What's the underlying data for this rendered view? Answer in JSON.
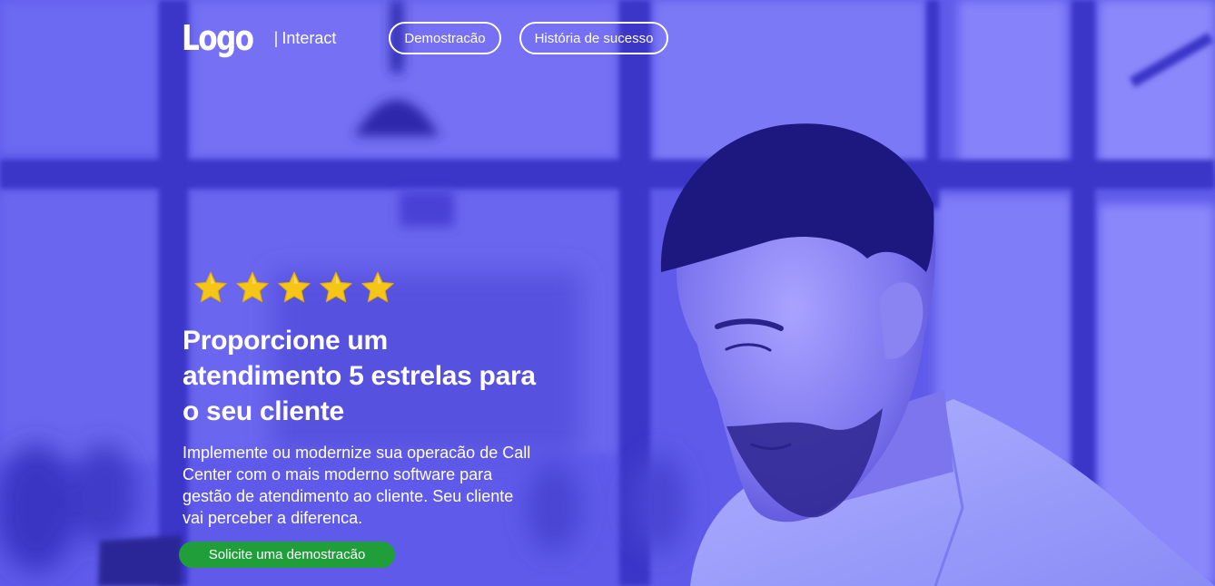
{
  "header": {
    "logo_text": "Logo",
    "brand_separator": "|",
    "brand_name": "Interact",
    "nav_buttons": [
      {
        "label": "Demostracão"
      },
      {
        "label": "História de sucesso"
      }
    ]
  },
  "hero": {
    "rating_stars": 5,
    "rating_max": 5,
    "headline_lines": [
      "Proporcione um",
      "atendimento 5 estrelas para",
      "o seu cliente"
    ],
    "description": "Implemente ou modernize sua operacão de Call Center com o mais moderno software para gestão de atendimento ao cliente. Seu cliente vai perceber a diferenca.",
    "cta_label": "Solicite uma demostracão"
  },
  "icons": {
    "star": "star-icon",
    "background_photo": "man-at-office-photo"
  },
  "colors": {
    "overlay": "#5b55e8",
    "overlay_dark": "#2e27a8",
    "star": "#f5c518",
    "cta": "#1f9e39",
    "text": "#ffffff"
  }
}
